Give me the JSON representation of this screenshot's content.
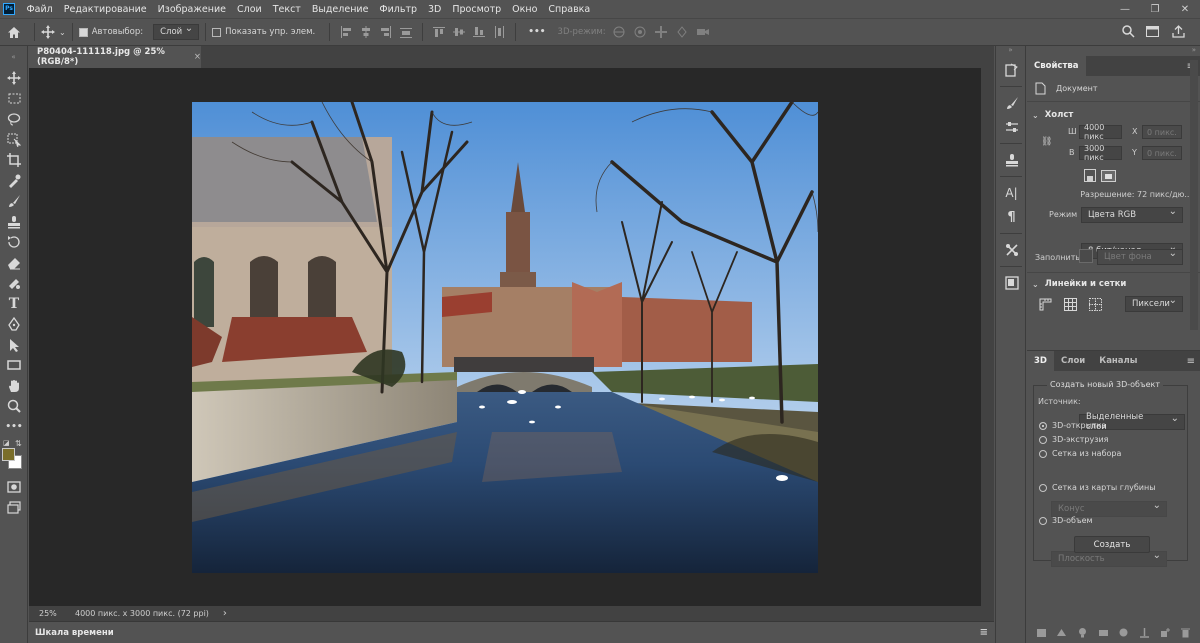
{
  "app": {
    "logo": "Ps"
  },
  "menu": [
    "Файл",
    "Редактирование",
    "Изображение",
    "Слои",
    "Текст",
    "Выделение",
    "Фильтр",
    "3D",
    "Просмотр",
    "Окно",
    "Справка"
  ],
  "options": {
    "autoselect_label": "Автовыбор:",
    "autoselect_value": "Слой",
    "show_transform_label": "Показать упр. элем.",
    "mode3d_label": "3D-режим:",
    "more": "•••"
  },
  "document": {
    "tab_title": "P80404-111118.jpg @ 25% (RGB/8*)",
    "close": "×",
    "zoom": "25%",
    "status": "4000 пикс. x 3000 пикс. (72 ppi)",
    "status_arrow": "›"
  },
  "timeline": {
    "title": "Шкала времени"
  },
  "properties": {
    "tab": "Свойства",
    "kind": "Документ",
    "canvas_section": "Холст",
    "w_label": "Ш",
    "w_value": "4000 пикс",
    "h_label": "В",
    "h_value": "3000 пикс",
    "x_label": "X",
    "x_placeholder": "0 пикс.",
    "y_label": "Y",
    "y_placeholder": "0 пикс.",
    "resolution": "Разрешение: 72 пикс/дю...",
    "mode_label": "Режим",
    "mode_value": "Цвета RGB",
    "depth_value": "8 бит/канал",
    "fill_label": "Заполнить",
    "fill_value": "Цвет фона",
    "rulers_section": "Линейки и сетки",
    "units_value": "Пиксели"
  },
  "panel3d": {
    "tabs": [
      "3D",
      "Слои",
      "Каналы"
    ],
    "create_title": "Создать новый 3D-объект",
    "source_label": "Источник:",
    "source_value": "Выделенные слои",
    "options": [
      "3D-открытка",
      "3D-экструзия",
      "Сетка из набора",
      "Сетка из карты глубины",
      "3D-объем"
    ],
    "preset_value": "Конус",
    "depth_map_value": "Плоскость",
    "create_button": "Создать"
  },
  "colors": {
    "foreground": "#7a6e2a",
    "background": "#ffffff"
  }
}
